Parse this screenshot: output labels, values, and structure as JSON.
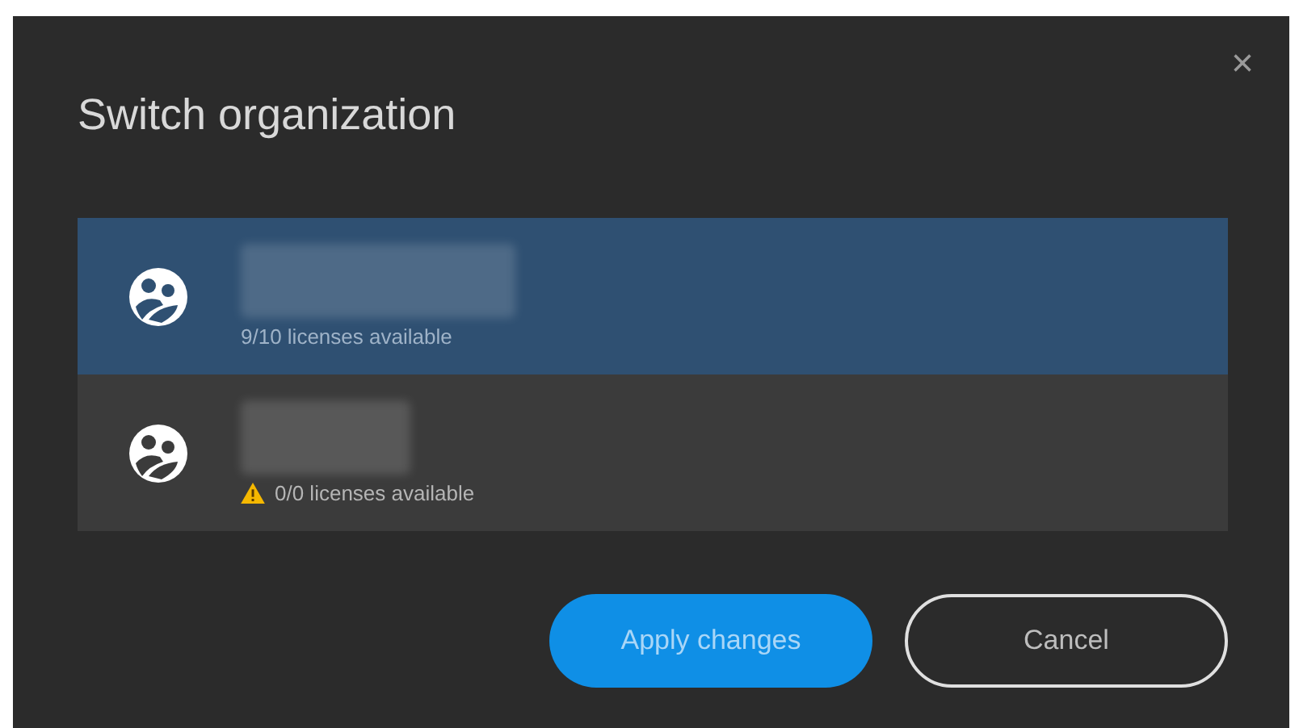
{
  "dialog": {
    "title": "Switch organization",
    "close": "×"
  },
  "organizations": [
    {
      "selected": true,
      "warning": false,
      "licenses": "9/10 licenses available"
    },
    {
      "selected": false,
      "warning": true,
      "licenses": "0/0 licenses available"
    }
  ],
  "buttons": [
    {
      "kind": "primary",
      "label": "Apply changes"
    },
    {
      "kind": "secondary",
      "label": "Cancel"
    }
  ]
}
